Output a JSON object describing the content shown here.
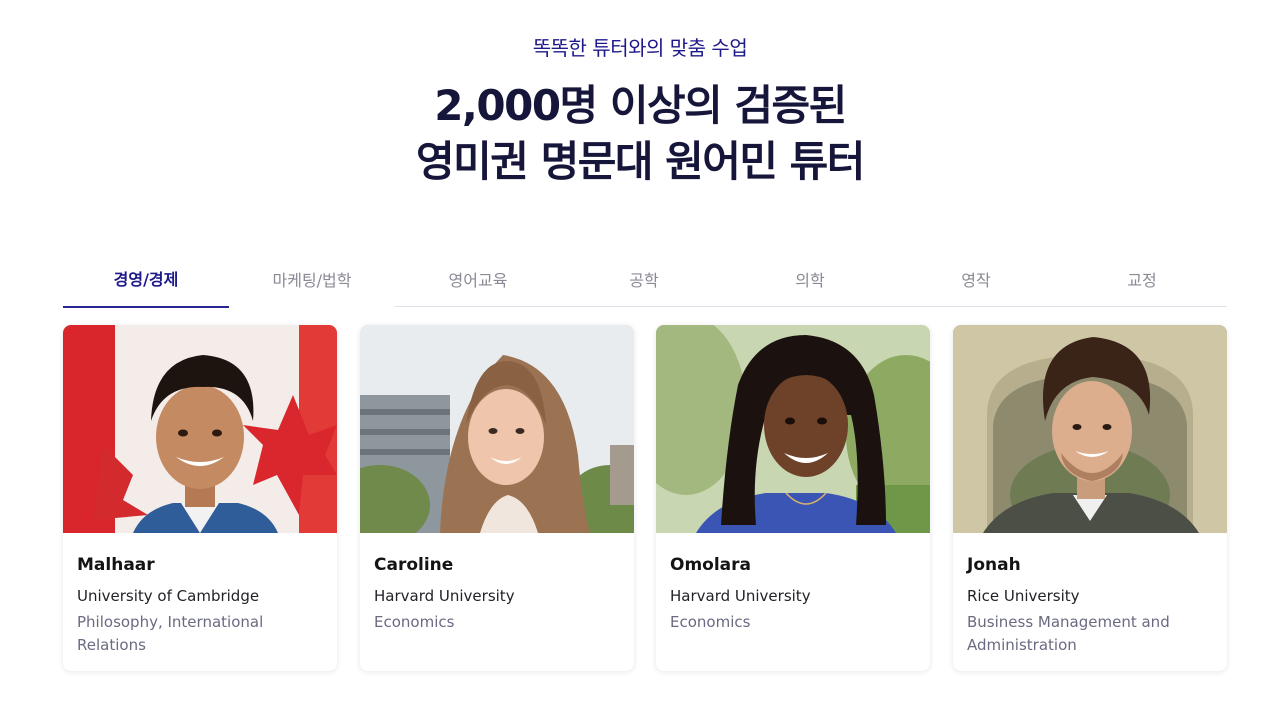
{
  "header": {
    "eyebrow": "똑똑한 튜터와의 맞춤 수업",
    "title_line1": "2,000명 이상의 검증된",
    "title_line2": "영미권 명문대 원어민 튜터"
  },
  "tabs": [
    {
      "label": "경영/경제",
      "active": true
    },
    {
      "label": "마케팅/법학",
      "active": false
    },
    {
      "label": "영어교육",
      "active": false
    },
    {
      "label": "공학",
      "active": false
    },
    {
      "label": "의학",
      "active": false
    },
    {
      "label": "영작",
      "active": false
    },
    {
      "label": "교정",
      "active": false
    }
  ],
  "tutors": [
    {
      "name": "Malhaar",
      "university": "University of Cambridge",
      "major": "Philosophy, International Relations"
    },
    {
      "name": "Caroline",
      "university": "Harvard University",
      "major": "Economics"
    },
    {
      "name": "Omolara",
      "university": "Harvard University",
      "major": "Economics"
    },
    {
      "name": "Jonah",
      "university": "Rice University",
      "major": "Business Management and Administration"
    }
  ],
  "colors": {
    "accent": "#1f1a8a",
    "headline": "#16163a",
    "muted_text": "#6a6a82",
    "tab_inactive": "#8a8a96"
  }
}
